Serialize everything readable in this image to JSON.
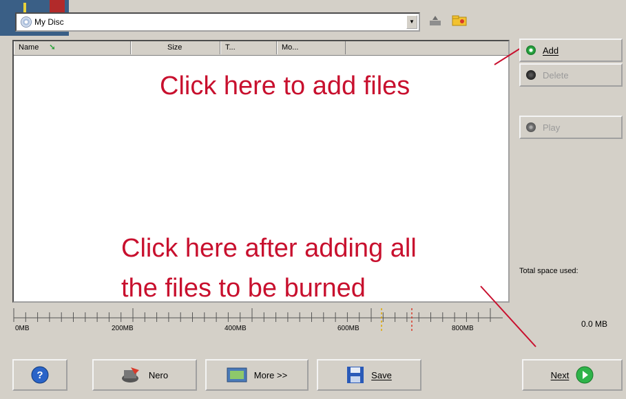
{
  "combo": {
    "label": "My Disc",
    "icon": "disc-icon"
  },
  "toolbar_icons": [
    "eject-icon",
    "folder-icon"
  ],
  "list": {
    "columns": [
      "Name",
      "Size",
      "T...",
      "Mo..."
    ],
    "sort_icon": "sort-arrow-icon",
    "rows": []
  },
  "annotations": {
    "add_hint": "Click here to add files",
    "next_hint_line1": "Click here after adding all",
    "next_hint_line2": "the files to be burned"
  },
  "side_buttons": {
    "add": "Add",
    "delete": "Delete",
    "play": "Play"
  },
  "space": {
    "label": "Total space used:",
    "value": "0.0 MB"
  },
  "ruler": {
    "labels": [
      "0MB",
      "200MB",
      "400MB",
      "600MB",
      "800MB"
    ]
  },
  "bottom_buttons": {
    "help": "help-icon",
    "nero": "Nero",
    "more": "More >>",
    "save": "Save",
    "next": "Next"
  },
  "colors": {
    "annotation": "#c8102e",
    "face": "#d4d0c8",
    "accent_green": "#2fb34a",
    "help_blue": "#2a64c8"
  }
}
